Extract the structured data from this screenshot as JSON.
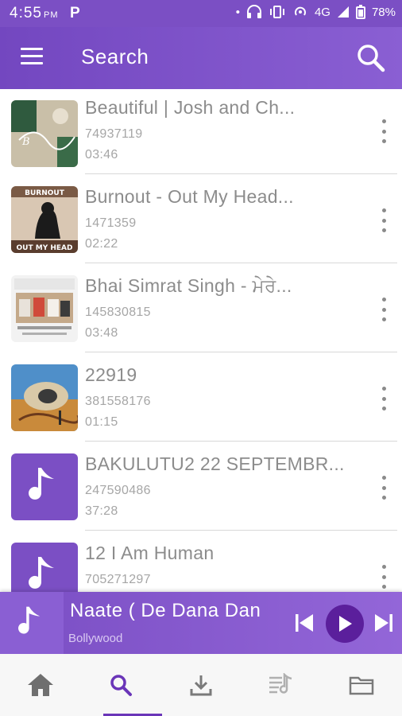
{
  "status_bar": {
    "time": "4:55",
    "ampm": "PM",
    "notif": "P",
    "network": "4G",
    "battery": "78%"
  },
  "toolbar": {
    "title": "Search",
    "menu_icon": "hamburger-menu-icon",
    "search_icon": "search-icon"
  },
  "results": [
    {
      "title": "Beautiful | Josh and Ch...",
      "id": "74937119",
      "duration": "03:46",
      "thumb": "photo"
    },
    {
      "title": "Burnout - Out My Head...",
      "id": "1471359",
      "duration": "02:22",
      "thumb": "photo"
    },
    {
      "title": "Bhai Simrat Singh - ਮੇਰੇ...",
      "id": "145830815",
      "duration": "03:48",
      "thumb": "photo"
    },
    {
      "title": "22919",
      "id": "381558176",
      "duration": "01:15",
      "thumb": "photo"
    },
    {
      "title": "BAKULUTU2 22 SEPTEMBR...",
      "id": "247590486",
      "duration": "37:28",
      "thumb": "music-note"
    },
    {
      "title": "12 I Am Human",
      "id": "705271297",
      "duration": "",
      "thumb": "music-note"
    }
  ],
  "thumb_labels": {
    "burnout_top": "BURNOUT",
    "burnout_bottom": "OUT MY HEAD"
  },
  "player": {
    "title": "Naate ( De Dana Dan",
    "subtitle": "Bollywood"
  },
  "bottom_nav": {
    "items": [
      "home",
      "search",
      "download",
      "playlist",
      "folder"
    ],
    "active": "search"
  },
  "colors": {
    "primary": "#7b4fc4",
    "play_button": "#5b1f9c",
    "text_muted": "#8c8c8c"
  }
}
